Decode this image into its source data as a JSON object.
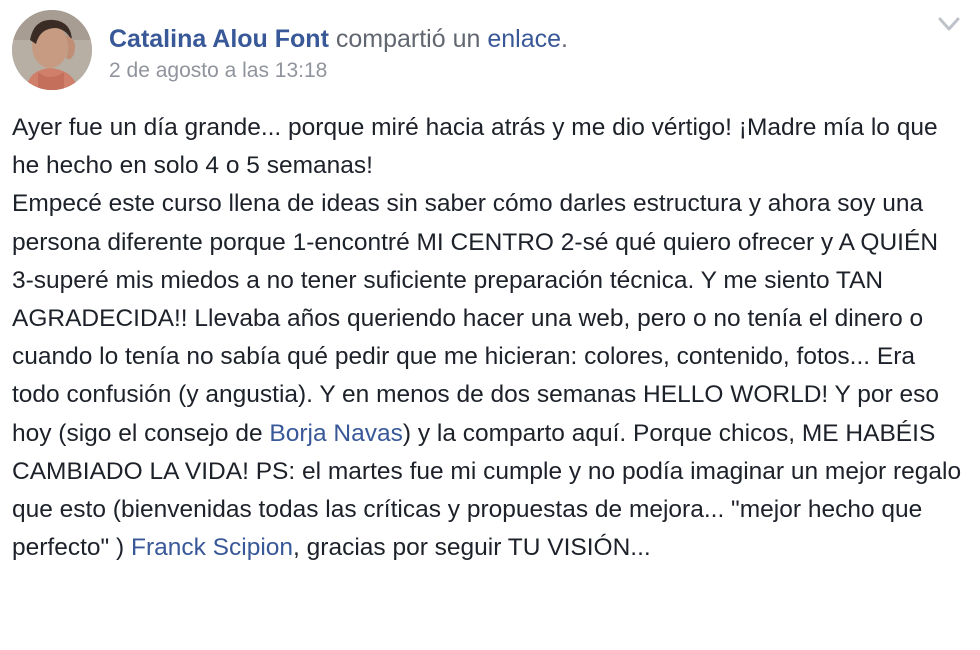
{
  "post": {
    "author": "Catalina Alou Font",
    "action": "compartió un",
    "link_word": "enlace",
    "action_end": ".",
    "timestamp": "2 de agosto a las 13:18",
    "menu_icon": "chevron-down-icon",
    "body": {
      "part1": "Ayer fue un día grande... porque miré hacia atrás y me dio vértigo! ¡Madre mía lo que he hecho en solo 4 o 5 semanas!",
      "part2": "Empecé este curso llena de ideas sin saber cómo darles estructura y ahora soy una persona diferente porque 1-encontré MI CENTRO 2-sé qué quiero ofrecer y A QUIÉN 3-superé mis miedos a no tener suficiente preparación técnica. Y me siento TAN AGRADECIDA!! Llevaba años queriendo hacer una web, pero o no tenía el dinero o cuando lo tenía no sabía qué pedir que me hicieran: colores, contenido, fotos... Era todo confusión (y angustia). Y en menos de dos semanas HELLO WORLD! Y por eso hoy (sigo el consejo de ",
      "mention1": "Borja Navas",
      "part3": ") y la comparto aquí. Porque chicos, ME HABÉIS CAMBIADO LA VIDA! PS: el martes fue mi cumple y no podía imaginar un mejor regalo que esto (bienvenidas todas las críticas y propuestas de mejora... \"mejor hecho que perfecto\" ) ",
      "mention2": "Franck Scipion",
      "part4": ", gracias por seguir TU VISIÓN..."
    }
  },
  "colors": {
    "link": "#385898",
    "text": "#1d2129",
    "meta": "#90949c",
    "action": "#616770"
  }
}
